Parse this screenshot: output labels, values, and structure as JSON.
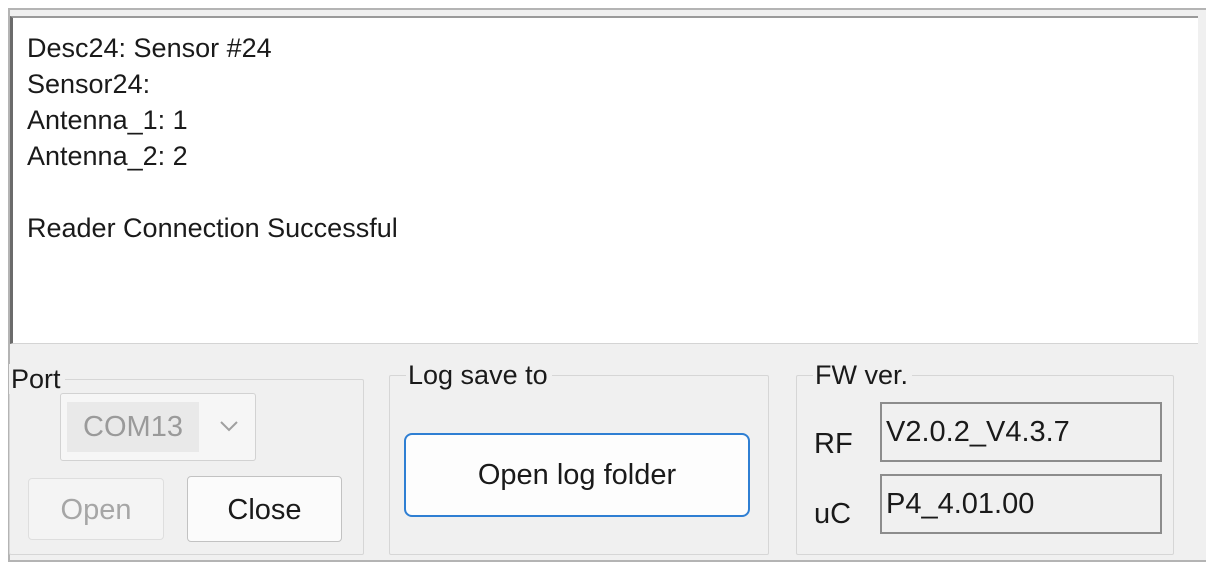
{
  "log": {
    "lines": [
      "Desc24: Sensor #24",
      "Sensor24:",
      "Antenna_1: 1",
      "Antenna_2: 2",
      "",
      "Reader Connection Successful"
    ]
  },
  "port": {
    "group_label": "Port",
    "selected": "COM13",
    "open_label": "Open",
    "close_label": "Close"
  },
  "log_save": {
    "group_label": "Log save to",
    "button_label": "Open log folder"
  },
  "fw": {
    "group_label": "FW ver.",
    "rf_label": "RF",
    "rf_value": "V2.0.2_V4.3.7",
    "uc_label": "uC",
    "uc_value": "P4_4.01.00"
  },
  "colors": {
    "window_bg": "#f0f0f0",
    "focus_border": "#2f7fd3",
    "disabled_text": "#a6a6a6"
  },
  "icons": {
    "combo_arrow": "chevron-down-icon"
  }
}
